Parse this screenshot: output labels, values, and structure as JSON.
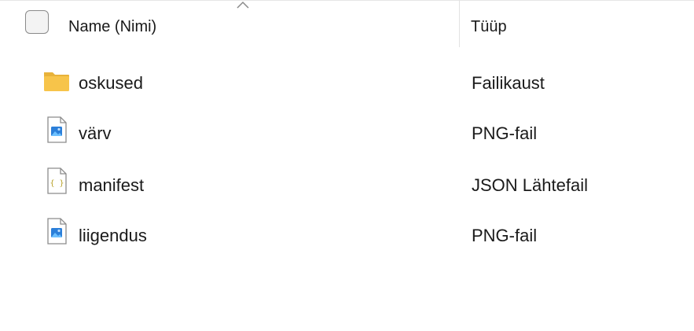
{
  "header": {
    "name_label": "Name (Nimi)",
    "type_label": "Tüüp",
    "sort_indicator_icon": "chevron-up-icon"
  },
  "files": [
    {
      "name": "oskused",
      "type": "Failikaust",
      "icon": "folder-icon"
    },
    {
      "name": "värv",
      "type": "PNG-fail",
      "icon": "image-file-icon"
    },
    {
      "name": "manifest",
      "type": "JSON Lähtefail",
      "icon": "json-file-icon"
    },
    {
      "name": "liigendus",
      "type": "PNG-fail",
      "icon": "image-file-icon"
    }
  ],
  "colors": {
    "folder": "#f7c44a",
    "image_accent": "#2b7fd9",
    "json_braces": "#b8a22a",
    "text": "#1a1a1a"
  }
}
